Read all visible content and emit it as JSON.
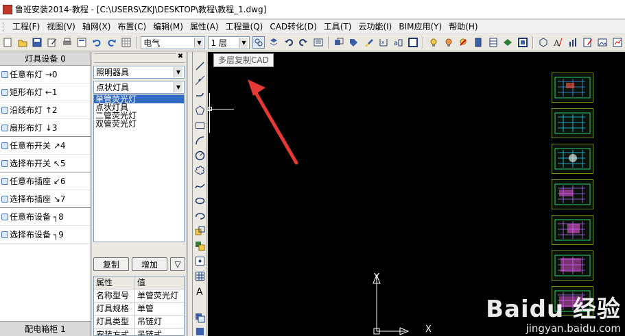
{
  "window": {
    "title": "鲁班安装2014-教程 - [C:\\USERS\\ZKJ\\DESKTOP\\教程\\教程_1.dwg]"
  },
  "menu": [
    {
      "label": "工程(F)"
    },
    {
      "label": "视图(V)"
    },
    {
      "label": "轴网(X)"
    },
    {
      "label": "布置(C)"
    },
    {
      "label": "编辑(M)"
    },
    {
      "label": "属性(A)"
    },
    {
      "label": "工程量(Q)"
    },
    {
      "label": "CAD转化(D)"
    },
    {
      "label": "工具(T)"
    },
    {
      "label": "云功能(I)"
    },
    {
      "label": "BIM应用(Y)"
    },
    {
      "label": "帮助(H)"
    }
  ],
  "toolbar": {
    "discipline_value": "电气",
    "floor_value": "1 层",
    "tooltip": "多层复制CAD"
  },
  "left_panel": {
    "header": "灯具设备 0",
    "items": [
      {
        "label": "任意布灯",
        "shortcut": "→0"
      },
      {
        "label": "矩形布灯",
        "shortcut": "←1"
      },
      {
        "label": "沿线布灯",
        "shortcut": "↑2"
      },
      {
        "label": "扇形布灯",
        "shortcut": "↓3"
      },
      {
        "label": "任意布开关",
        "shortcut": "↗4"
      },
      {
        "label": "选择布开关",
        "shortcut": "↖5"
      },
      {
        "label": "任意布插座",
        "shortcut": "↙6"
      },
      {
        "label": "选择布插座",
        "shortcut": "↘7"
      },
      {
        "label": "任意布设备",
        "shortcut": "┐8"
      },
      {
        "label": "选择布设备",
        "shortcut": "┐9"
      }
    ],
    "footer": "配电箱柜 1"
  },
  "mid_panel": {
    "category_value": "照明器具",
    "subcategory_value": "点状灯具",
    "list_items": [
      {
        "label": "单管荧光灯",
        "selected": true
      },
      {
        "label": "点状灯具",
        "selected": false
      },
      {
        "label": "二管荧光灯",
        "selected": false
      },
      {
        "label": "双管荧光灯",
        "selected": false
      }
    ],
    "copy_button": "复制",
    "add_button": "增加",
    "properties": {
      "col_attr": "属性",
      "col_value": "值",
      "rows": [
        {
          "name": "名称型号",
          "value": "单管荧光灯"
        },
        {
          "name": "灯具规格",
          "value": "单管"
        },
        {
          "name": "灯具类型",
          "value": "吊链灯"
        },
        {
          "name": "安装方式",
          "value": "吊链式"
        }
      ]
    }
  },
  "canvas": {
    "axis_y": "Y",
    "axis_x": "X",
    "watermark_logo": "Baidu 经验",
    "watermark_url": "jingyan.baidu.com"
  },
  "colors": {
    "canvas_bg": "#000000",
    "selection": "#316ac5",
    "arrow": "#e53935"
  }
}
